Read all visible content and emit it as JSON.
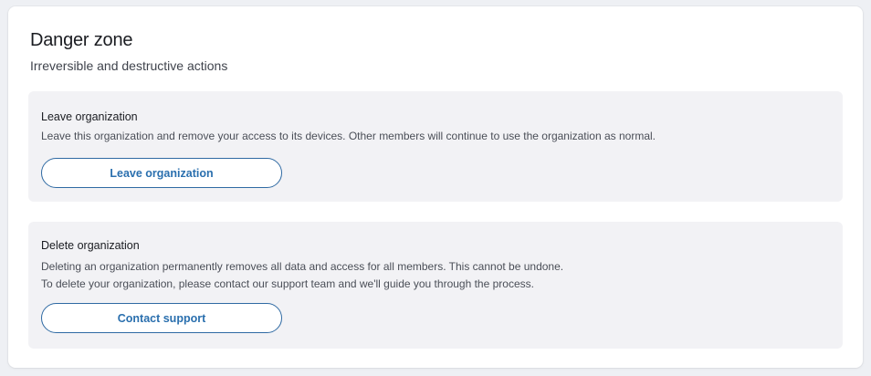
{
  "danger_zone": {
    "title": "Danger zone",
    "subtitle": "Irreversible and destructive actions"
  },
  "leave_section": {
    "title": "Leave organization",
    "description": "Leave this organization and remove your access to its devices. Other members will continue to use the organization as normal.",
    "button_label": "Leave organization"
  },
  "delete_section": {
    "title": "Delete organization",
    "description_line1": "Deleting an organization permanently removes all data and access for all members. This cannot be undone.",
    "description_line2": "To delete your organization, please contact our support team and we'll guide you through the process.",
    "button_label": "Contact support"
  },
  "colors": {
    "page_background": "#eef0f4",
    "card_background": "#ffffff",
    "section_background": "#f2f2f5",
    "button_accent": "#2a6fae",
    "heading_text": "#1a1c21"
  }
}
